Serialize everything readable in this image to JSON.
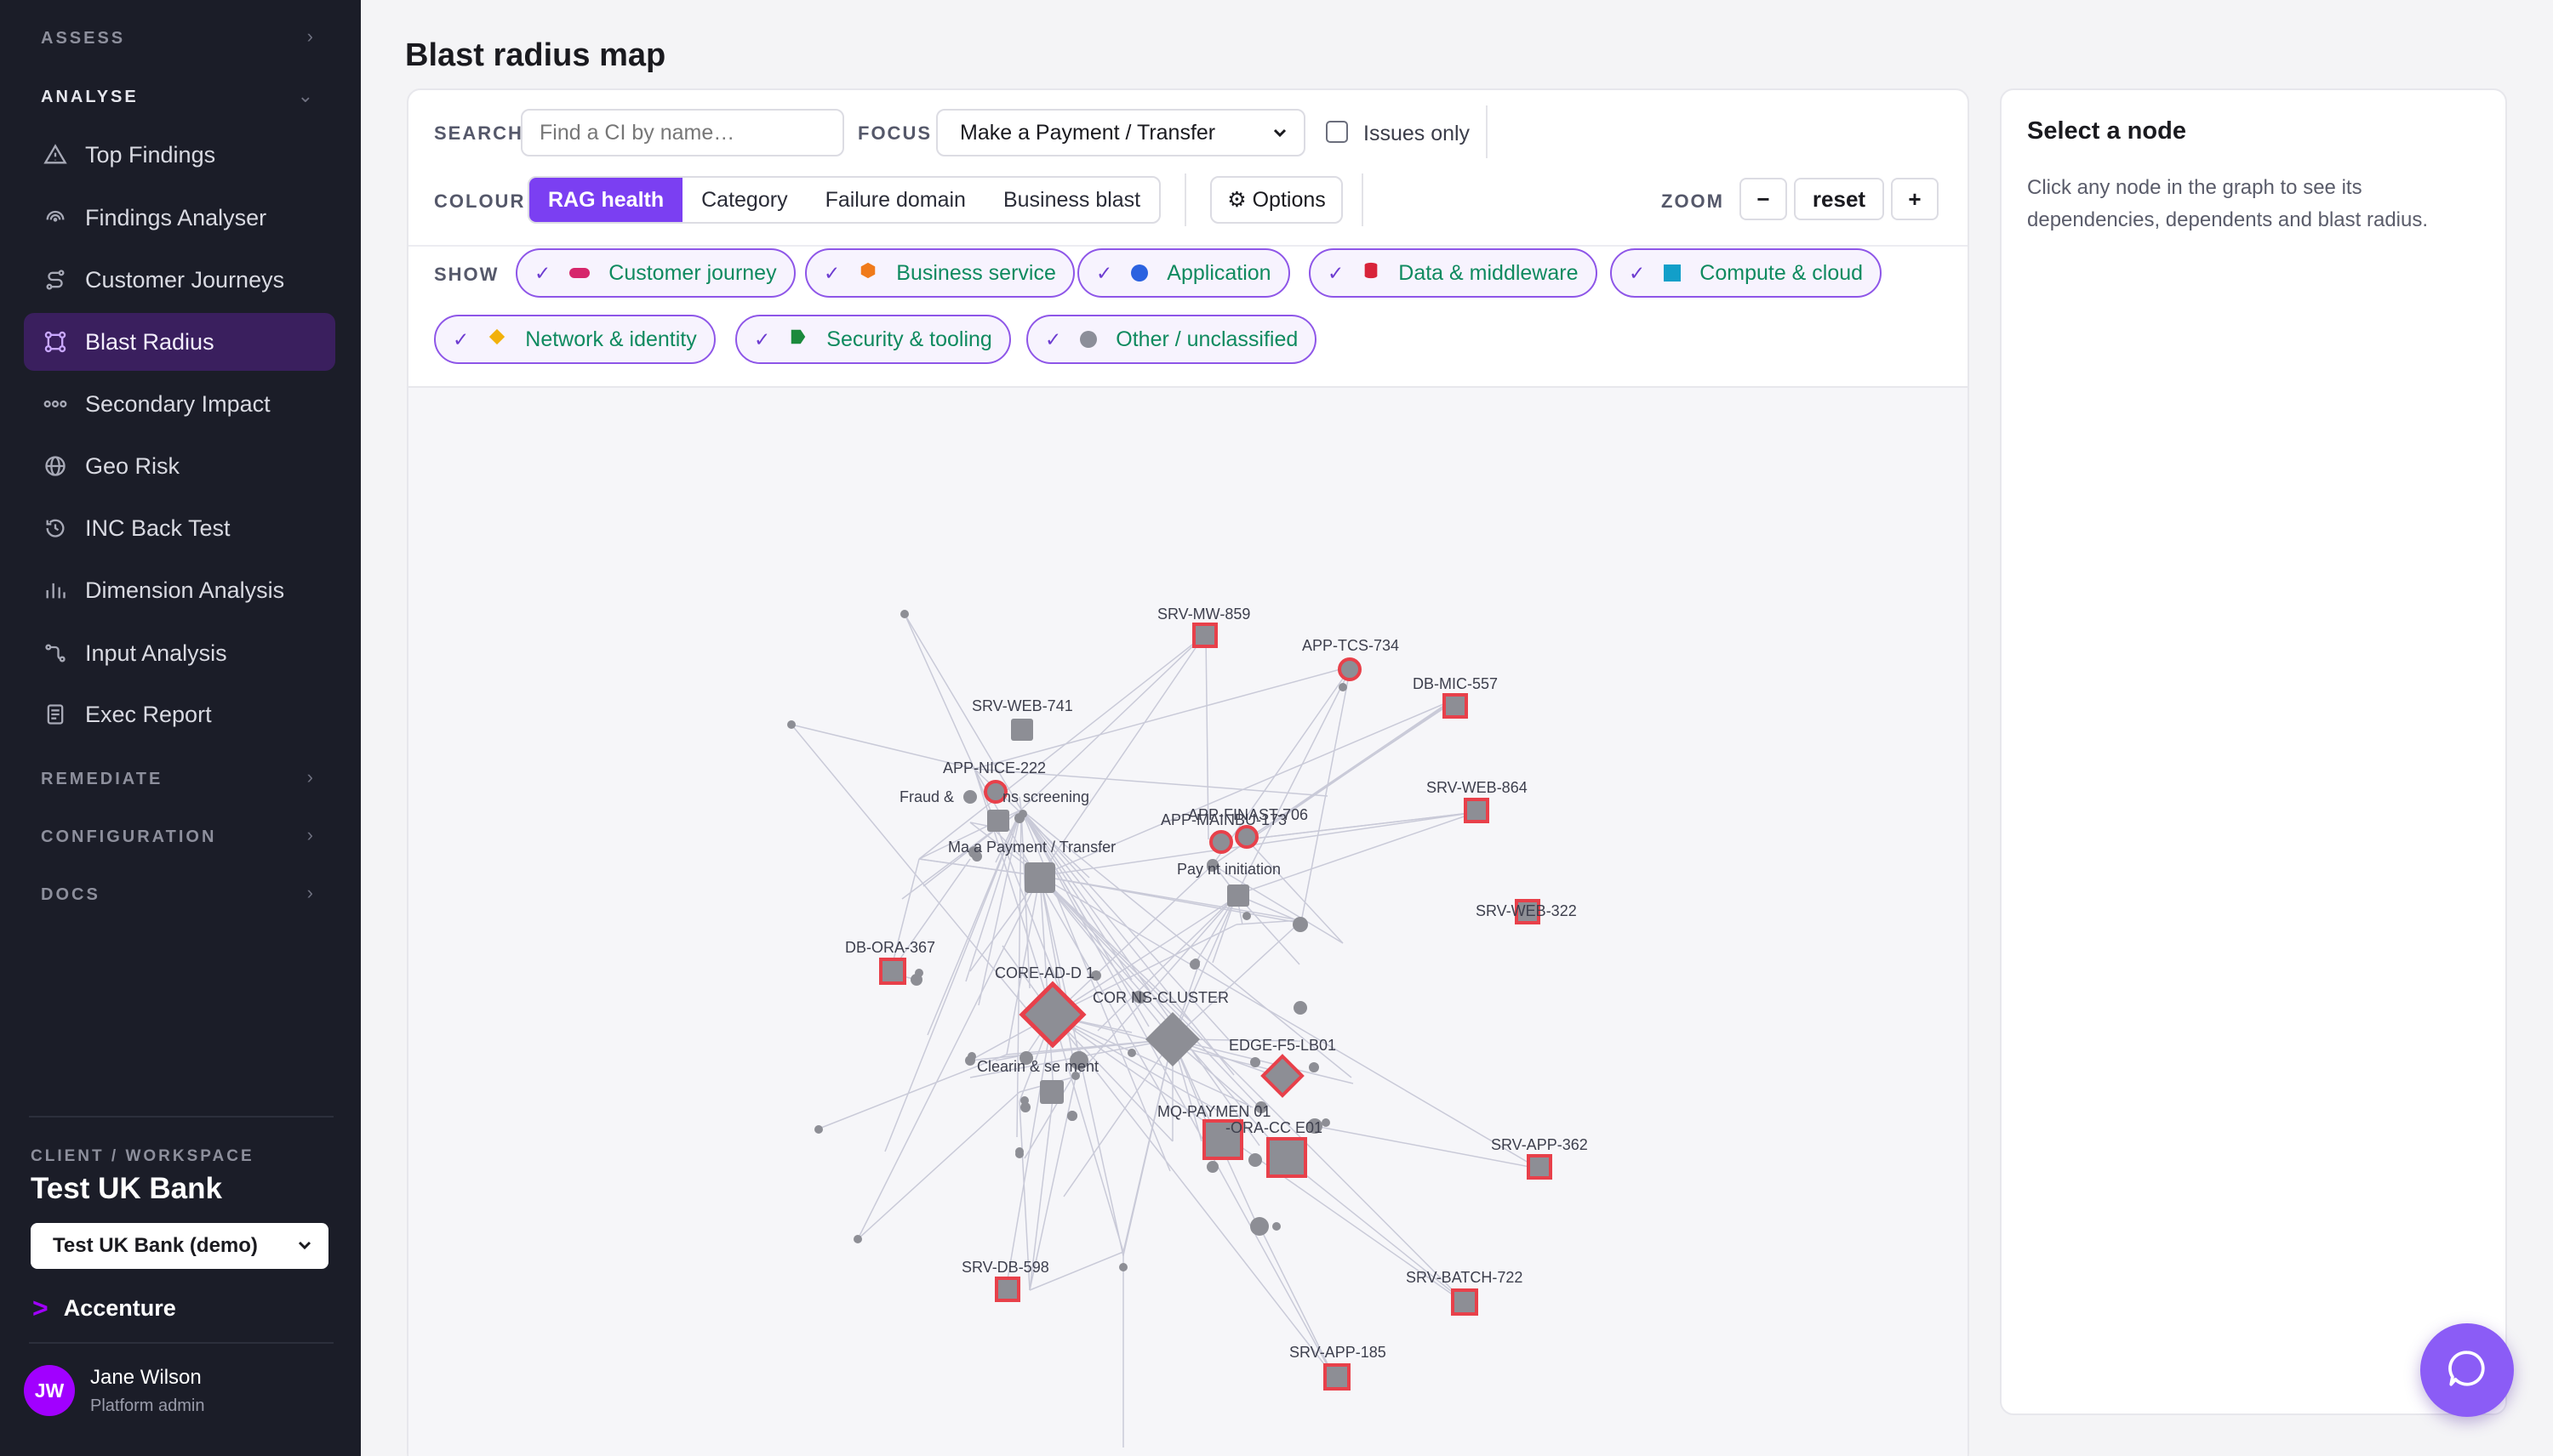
{
  "sidebar": {
    "sections": {
      "assess": "ASSESS",
      "analyse": "ANALYSE",
      "remediate": "REMEDIATE",
      "configuration": "CONFIGURATION",
      "docs": "DOCS"
    },
    "items": [
      {
        "label": "Top Findings",
        "icon": "warning-triangle-icon"
      },
      {
        "label": "Findings Analyser",
        "icon": "radar-icon"
      },
      {
        "label": "Customer Journeys",
        "icon": "journey-path-icon"
      },
      {
        "label": "Blast Radius",
        "icon": "network-nodes-icon",
        "active": true
      },
      {
        "label": "Secondary Impact",
        "icon": "chain-dots-icon"
      },
      {
        "label": "Geo Risk",
        "icon": "globe-icon"
      },
      {
        "label": "INC Back Test",
        "icon": "history-clock-icon"
      },
      {
        "label": "Dimension Analysis",
        "icon": "bar-chart-icon"
      },
      {
        "label": "Input Analysis",
        "icon": "input-flow-icon"
      },
      {
        "label": "Exec Report",
        "icon": "document-icon"
      }
    ],
    "workspace_label": "CLIENT / WORKSPACE",
    "workspace_name": "Test UK Bank",
    "workspace_select": "Test UK Bank (demo)",
    "brand": "Accenture",
    "user": {
      "initials": "JW",
      "name": "Jane Wilson",
      "role": "Platform admin"
    }
  },
  "main": {
    "title": "Blast radius map",
    "toolbar": {
      "search_label": "SEARCH",
      "search_placeholder": "Find a CI by name…",
      "focus_label": "FOCUS",
      "focus_value": "Make a Payment / Transfer",
      "issues_only": "Issues only",
      "colour_label": "COLOUR",
      "colour_options": [
        "RAG health",
        "Category",
        "Failure domain",
        "Business blast"
      ],
      "options_label": "⚙ Options",
      "zoom_label": "ZOOM",
      "zoom_out": "−",
      "zoom_reset": "reset",
      "zoom_in": "+",
      "show_label": "SHOW"
    },
    "filters": [
      {
        "label": "Customer journey",
        "color": "#d6276b",
        "shape": "pill"
      },
      {
        "label": "Business service",
        "color": "#f07a1a",
        "shape": "hexagon"
      },
      {
        "label": "Application",
        "color": "#2b62e0",
        "shape": "circle"
      },
      {
        "label": "Data & middleware",
        "color": "#d8243a",
        "shape": "cylinder"
      },
      {
        "label": "Compute & cloud",
        "color": "#129fc9",
        "shape": "square"
      },
      {
        "label": "Network & identity",
        "color": "#f2b10a",
        "shape": "diamond"
      },
      {
        "label": "Security & tooling",
        "color": "#1b8a3c",
        "shape": "shield"
      },
      {
        "label": "Other / unclassified",
        "color": "#8c8e99",
        "shape": "circle"
      }
    ]
  },
  "graph": {
    "labels": {
      "srv_mw_859": "SRV-MW-859",
      "app_tcs_734": "APP-TCS-734",
      "db_mic_557": "DB-MIC-557",
      "srv_web_741": "SRV-WEB-741",
      "app_nice_222": "APP-NICE-222",
      "fraud": "Fraud &",
      "screening": "ns screening",
      "make_payment": "Ma  a Payment / Transfer",
      "app_finast": "APP-FINAST-706",
      "app_mainbu": "APP-MAINBU-173",
      "srv_web_864": "SRV-WEB-864",
      "pay_init": "Pay   nt initiation",
      "srv_web_322": "SRV-WEB-322",
      "db_ora_367": "DB-ORA-367",
      "core_ad": "CORE-AD-D   1",
      "cor_cluster": "COR   NS-CLUSTER",
      "edge_f5": "EDGE-F5-LB01",
      "clearing": "Clearin  & se   ment",
      "mq_payment": "MQ-PAYMEN    01",
      "ora_core": "   -ORA-CC   E01",
      "srv_app_362": "SRV-APP-362",
      "srv_db_598": "SRV-DB-598",
      "srv_batch_722": "SRV-BATCH-722",
      "srv_app_185": "SRV-APP-185"
    }
  },
  "side_panel": {
    "title": "Select a node",
    "text": "Click any node in the graph to see its dependencies, dependents and blast radius."
  }
}
